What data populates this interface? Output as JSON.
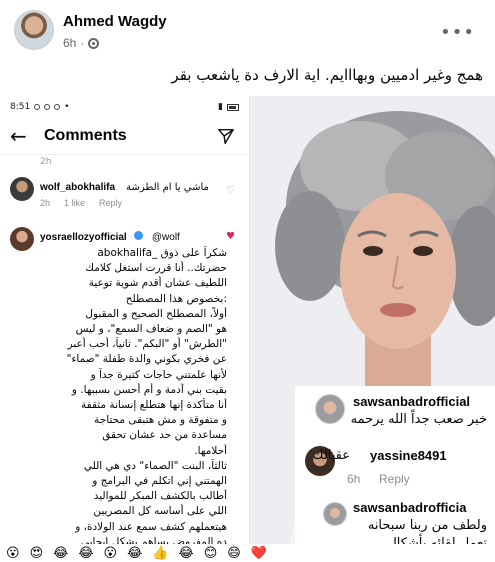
{
  "post": {
    "author": "Ahmed Wagdy",
    "time": "6h",
    "text": "همج وغير ادميين وبهااايم. اية الارف دة ياشعب بقر"
  },
  "phone": {
    "status_time": "8:51",
    "title": "Comments",
    "cut_off_text": "2h",
    "comment1": {
      "user": "wolf_abokhalifa",
      "text": "ماشي يا ام الطرشة",
      "time": "2h",
      "likes": "1 like",
      "reply": "Reply"
    },
    "comment2": {
      "user": "yosraellozyofficial",
      "mention": "@wolf",
      "lines": [
        "شكراً على ذوق _abokhalifa",
        "حضرتك.. أنا قررت استغل كلامك",
        "اللطيف عشان أقدم شوية توعية",
        ":بخصوص هذا المصطلح",
        "أولاً، المصطلح الصحيح و المقبول",
        "هو \"الصم و ضعاف السمع\"، و ليس",
        "\"الطرش\" أو \"البكم\". ثانياً، أحب أعبر",
        "عن فخري بكوني والدة طفلة \"صماء\"",
        "لأنها علمتني حاجات كتيرة جداً و",
        "بقيت بني آدمة و أم أحسن بسببها. و",
        "أنا متأكدة إنها هتطلع إنسانة مثقفة",
        "و متفوقة و مش هتبقى محتاجة",
        "مساعدة من حد عشان تحقق",
        "أحلامها.",
        "ثالثاً، البنت \"الصماء\" دي هي اللي",
        "الهمتني إني اتكلم في البرامج و",
        "أطالب بالكشف المبكر للمواليد",
        "اللي على أساسه كل المصريين",
        "هيتعملهم كشف سمع عند الولادة، و",
        "ده المفروض يساهم بشكل ايجابي"
      ]
    }
  },
  "overlay": {
    "c1_user": "sawsanbadrofficial",
    "c1_text": "خبر صعب جداً الله يرحمه",
    "c2_user": "yassine8491",
    "c2_text": "عقبالك",
    "c2_time": "6h",
    "c2_reply": "Reply",
    "c3_user": "sawsanbadrofficia",
    "c3_text1": "ولطف من ربنا سبحانه",
    "c3_text2": "تعمل لقائه بأشكال"
  },
  "reactions": [
    "😮",
    "😍",
    "😂",
    "😂",
    "😮",
    "😂",
    "👍",
    "😂",
    "😊",
    "😄",
    "❤️"
  ]
}
